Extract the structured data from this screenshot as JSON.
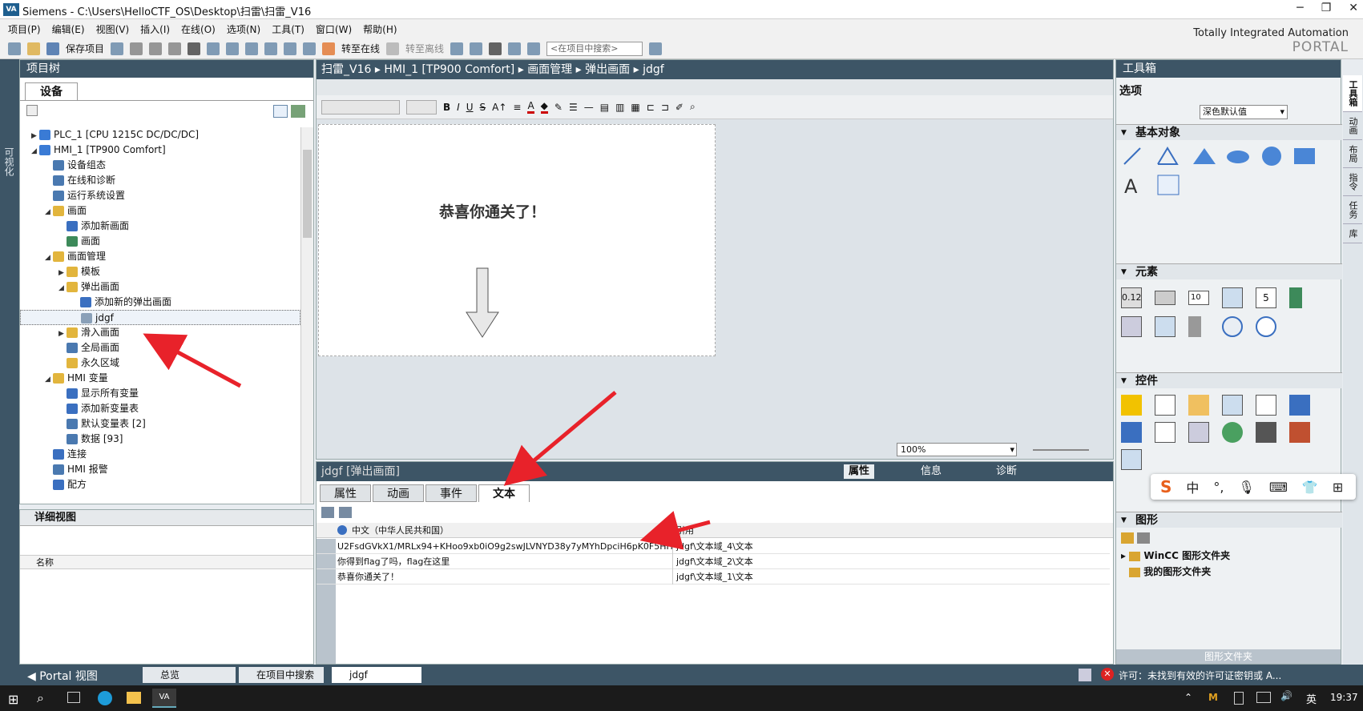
{
  "window": {
    "app": "Siemens",
    "title": "Siemens  -  C:\\Users\\HelloCTF_OS\\Desktop\\扫雷\\扫雷_V16"
  },
  "menu": [
    "项目(P)",
    "编辑(E)",
    "视图(V)",
    "插入(I)",
    "在线(O)",
    "选项(N)",
    "工具(T)",
    "窗口(W)",
    "帮助(H)"
  ],
  "toolbar": {
    "save": "保存项目",
    "go_online": "转至在线",
    "go_offline": "转至离线",
    "search_placeholder": "<在项目中搜索>"
  },
  "brand": {
    "line1": "Totally Integrated Automation",
    "line2": "PORTAL"
  },
  "left_strip": "可视化",
  "project_tree": {
    "title": "项目树",
    "tab": "设备",
    "rows": [
      {
        "label": "PLC_1 [CPU 1215C DC/DC/DC]",
        "level": 1,
        "toggle": "▶",
        "color": "#3a7bd5"
      },
      {
        "label": "HMI_1 [TP900 Comfort]",
        "level": 1,
        "toggle": "◢",
        "color": "#3a7bd5"
      },
      {
        "label": "设备组态",
        "level": 2,
        "toggle": "",
        "color": "#4a79b0"
      },
      {
        "label": "在线和诊断",
        "level": 2,
        "toggle": "",
        "color": "#4a79b0"
      },
      {
        "label": "运行系统设置",
        "level": 2,
        "toggle": "",
        "color": "#4a79b0"
      },
      {
        "label": "画面",
        "level": 2,
        "toggle": "◢",
        "color": "#e2b53d"
      },
      {
        "label": "添加新画面",
        "level": 3,
        "toggle": "",
        "color": "#3a6fc0"
      },
      {
        "label": "画面",
        "level": 3,
        "toggle": "",
        "color": "#3d8a5a"
      },
      {
        "label": "画面管理",
        "level": 2,
        "toggle": "◢",
        "color": "#e2b53d"
      },
      {
        "label": "模板",
        "level": 3,
        "toggle": "▶",
        "color": "#e2b53d"
      },
      {
        "label": "弹出画面",
        "level": 3,
        "toggle": "◢",
        "color": "#e2b53d"
      },
      {
        "label": "添加新的弹出画面",
        "level": 4,
        "toggle": "",
        "color": "#3a6fc0"
      },
      {
        "label": "jdgf",
        "level": 4,
        "toggle": "",
        "color": "#8aa0b8",
        "selected": true
      },
      {
        "label": "滑入画面",
        "level": 3,
        "toggle": "▶",
        "color": "#e2b53d"
      },
      {
        "label": "全局画面",
        "level": 3,
        "toggle": "",
        "color": "#4a79b0"
      },
      {
        "label": "永久区域",
        "level": 3,
        "toggle": "",
        "color": "#e2b53d"
      },
      {
        "label": "HMI 变量",
        "level": 2,
        "toggle": "◢",
        "color": "#e2b53d"
      },
      {
        "label": "显示所有变量",
        "level": 3,
        "toggle": "",
        "color": "#3a6fc0"
      },
      {
        "label": "添加新变量表",
        "level": 3,
        "toggle": "",
        "color": "#3a6fc0"
      },
      {
        "label": "默认变量表 [2]",
        "level": 3,
        "toggle": "",
        "color": "#4a79b0"
      },
      {
        "label": "数据 [93]",
        "level": 3,
        "toggle": "",
        "color": "#4a79b0"
      },
      {
        "label": "连接",
        "level": 2,
        "toggle": "",
        "color": "#3a6fc0"
      },
      {
        "label": "HMI 报警",
        "level": 2,
        "toggle": "",
        "color": "#4a79b0"
      },
      {
        "label": "配方",
        "level": 2,
        "toggle": "",
        "color": "#3a6fc0"
      }
    ]
  },
  "detail_view": {
    "title": "详细视图",
    "column": "名称"
  },
  "editor": {
    "breadcrumb": [
      "扫雷_V16",
      "HMI_1 [TP900 Comfort]",
      "画面管理",
      "弹出画面",
      "jdgf"
    ],
    "canvas_text": "恭喜你通关了！",
    "zoom": "100%"
  },
  "properties": {
    "title": "jdgf [弹出画面]",
    "right_tabs": [
      "属性",
      "信息",
      "诊断"
    ],
    "tabs": [
      "属性",
      "动画",
      "事件",
      "文本"
    ],
    "active_tab": "文本",
    "col_lang": "中文（中华人民共和国）",
    "col_ref": "引用",
    "rows": [
      {
        "text": "U2FsdGVkX1/MRLx94+KHoo9xb0iO9g2swJLVNYD38y7yMYhDpciH6pK0F5HHM",
        "ref": "jdgf\\文本域_4\\文本"
      },
      {
        "text": "你得到flag了吗，flag在这里",
        "ref": "jdgf\\文本域_2\\文本"
      },
      {
        "text": "恭喜你通关了！",
        "ref": "jdgf\\文本域_1\\文本"
      }
    ]
  },
  "toolbox": {
    "title": "工具箱",
    "options_label": "选项",
    "style_value": "深色默认值",
    "sections": [
      "基本对象",
      "元素",
      "控件",
      "图形"
    ],
    "graphics_items": [
      "WinCC 图形文件夹",
      "我的图形文件夹"
    ],
    "graphics_footer": "图形文件夹",
    "basic_text_glyph": "A",
    "elements_readouts": [
      "0.12",
      "10",
      "5"
    ]
  },
  "right_strip": [
    "工具箱",
    "动画",
    "布局",
    "指令",
    "任务",
    "库"
  ],
  "status": {
    "portal": "Portal 视图",
    "overview": "总览",
    "search": "在项目中搜索",
    "jdgf": "jdgf",
    "license": "许可：未找到有效的许可证密钥或 A..."
  },
  "ime": {
    "zh": "中",
    "punct": "°,"
  },
  "taskbar": {
    "lang": "英",
    "time": "19:37"
  }
}
